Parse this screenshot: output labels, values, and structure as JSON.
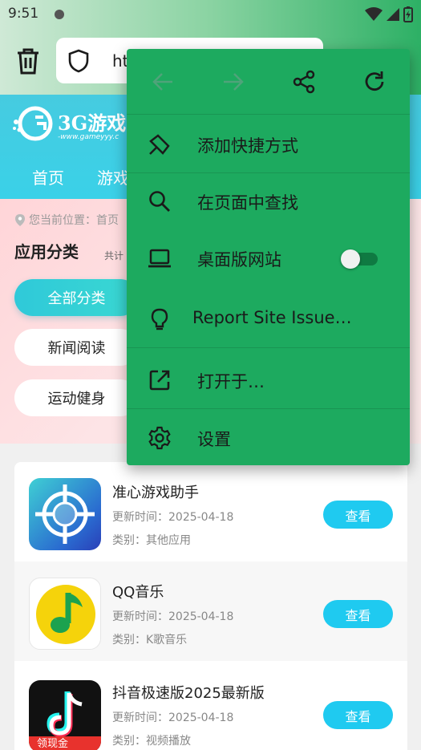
{
  "status_bar": {
    "time": "9:51"
  },
  "browser": {
    "url_text": "ht"
  },
  "site": {
    "logo_text": "3G游戏",
    "logo_sub": "-www.gameyyy.c",
    "nav": [
      "首页",
      "游戏"
    ]
  },
  "page": {
    "breadcrumb": "您当前位置：首页",
    "category_title": "应用分类",
    "category_count": "共计",
    "pills": [
      "全部分类",
      "新闻阅读",
      "运动健身"
    ]
  },
  "apps": [
    {
      "name": "准心游戏助手",
      "updated": "更新时间：2025-04-18",
      "category": "类别：其他应用",
      "button": "查看"
    },
    {
      "name": "QQ音乐",
      "updated": "更新时间：2025-04-18",
      "category": "类别：K歌音乐",
      "button": "查看"
    },
    {
      "name": "抖音极速版2025最新版",
      "updated": "更新时间：2025-04-18",
      "category": "类别：视频播放",
      "button": "查看",
      "badge": "领现金"
    }
  ],
  "menu": {
    "nav_icons": [
      "back-icon",
      "forward-icon",
      "share-icon",
      "reload-icon"
    ],
    "items": [
      {
        "label": "添加快捷方式",
        "icon": "add-shortcut-icon"
      },
      {
        "label": "在页面中查找",
        "icon": "search-icon"
      },
      {
        "label": "桌面版网站",
        "icon": "laptop-icon",
        "toggle": false
      },
      {
        "label": "Report Site Issue…",
        "icon": "lightbulb-icon"
      },
      {
        "label": "打开于…",
        "icon": "open-external-icon"
      },
      {
        "label": "设置",
        "icon": "gear-icon"
      }
    ]
  },
  "colors": {
    "menu_bg": "#1daa5f",
    "accent": "#1fcaf0",
    "header_bg": "#3ad1e8"
  }
}
